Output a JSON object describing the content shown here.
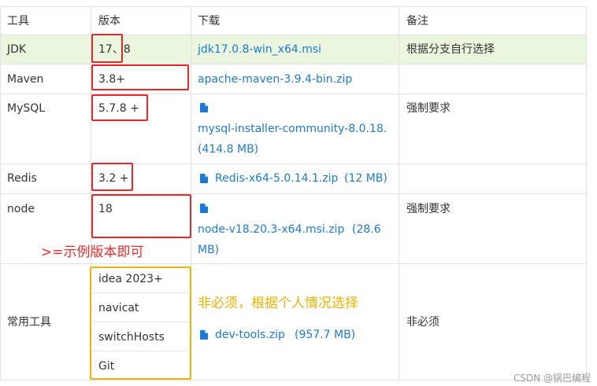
{
  "table": {
    "headers": [
      "工具",
      "版本",
      "下载",
      "备注"
    ],
    "rows": [
      {
        "tool": "JDK",
        "version": "17、8",
        "download": "jdk17.0.8-win_x64.msi",
        "note": "根据分支自行选择"
      },
      {
        "tool": "Maven",
        "version": "3.8+",
        "download": "apache-maven-3.9.4-bin.zip",
        "note": ""
      },
      {
        "tool": "MySQL",
        "version": "5.7.8 +",
        "download_line1": "mysql-installer-community-8.0.18.",
        "download_line2": "(414.8 MB)",
        "note": "强制要求"
      },
      {
        "tool": "Redis",
        "version": "3.2 +",
        "download": "Redis-x64-5.0.14.1.zip",
        "size": "(12 MB)",
        "note": ""
      },
      {
        "tool": "node",
        "version": "18",
        "download_line1": "node-v18.20.3-x64.msi.zip",
        "size": "(28.6",
        "download_line2": "MB)",
        "note": "强制要求"
      },
      {
        "tool": "常用工具",
        "versions": [
          "idea 2023+",
          "navicat",
          "switchHosts",
          "Git"
        ],
        "download": "dev-tools.zip",
        "size": "(957.7 MB)",
        "note": "非必须"
      }
    ]
  },
  "annotations": {
    "version_hint": ">=示例版本即可",
    "tools_hint": "非必须，根据个人情况选择"
  },
  "watermark": "CSDN @锅巴编程",
  "colors": {
    "highlight_row": "#eaf6dd",
    "link": "#1c7ad6",
    "red_annotation": "#e8272c",
    "orange_annotation": "#f4b400"
  },
  "icons": {
    "file": "file-icon"
  }
}
